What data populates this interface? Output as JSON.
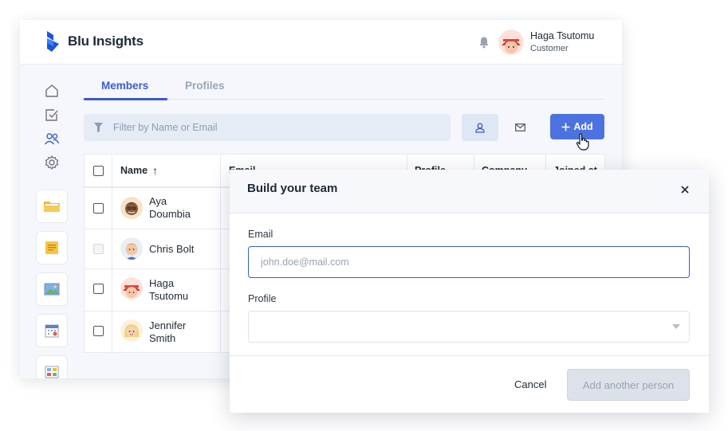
{
  "app": {
    "title": "Blu Insights"
  },
  "user": {
    "name": "Haga Tsutomu",
    "role": "Customer"
  },
  "tabs": [
    {
      "label": "Members",
      "active": true
    },
    {
      "label": "Profiles",
      "active": false
    }
  ],
  "filter": {
    "placeholder": "Filter by Name or Email"
  },
  "toolbar": {
    "add_label": "Add"
  },
  "table": {
    "columns": [
      "Name",
      "Email",
      "Profile",
      "Company",
      "Joined at"
    ],
    "sort_indicator": "↑",
    "rows": [
      {
        "name_line1": "Aya",
        "name_line2": "Doumbia"
      },
      {
        "name_line1": "Chris Bolt",
        "name_line2": ""
      },
      {
        "name_line1": "Haga",
        "name_line2": "Tsutomu"
      },
      {
        "name_line1": "Jennifer",
        "name_line2": "Smith"
      }
    ]
  },
  "modal": {
    "title": "Build your team",
    "email_label": "Email",
    "email_placeholder": "john.doe@mail.com",
    "profile_label": "Profile",
    "cancel_label": "Cancel",
    "submit_label": "Add another person"
  },
  "colors": {
    "accent": "#3b5bcc",
    "add_button": "#4b72e0",
    "background": "#f5f7fc"
  },
  "icons": {
    "nav": [
      "home-icon",
      "tasks-check-icon",
      "members-icon",
      "settings-gear-icon"
    ],
    "apps": [
      "folder-app-icon",
      "notes-app-icon",
      "image-app-icon",
      "calendar-app-icon",
      "map-app-icon"
    ]
  }
}
